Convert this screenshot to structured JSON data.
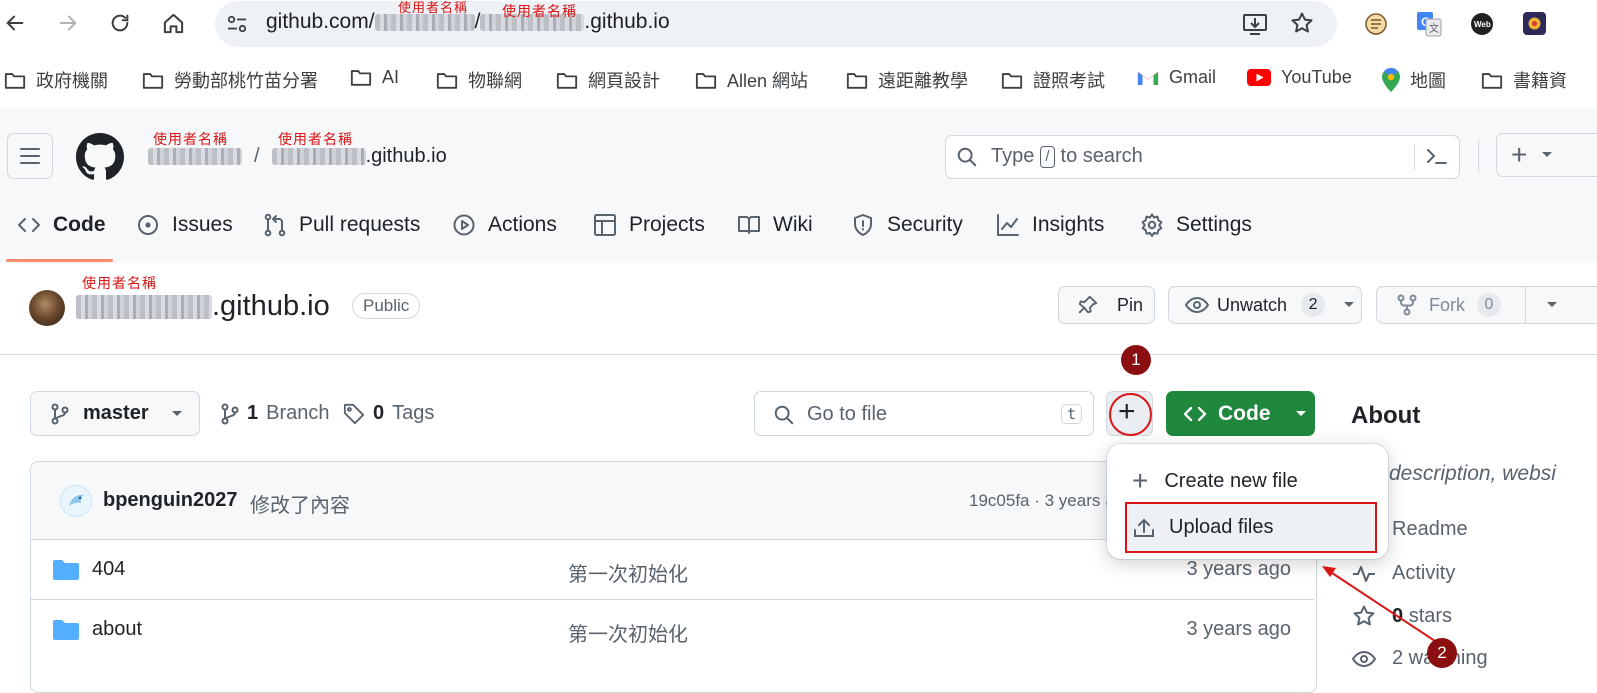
{
  "browser": {
    "url_prefix": "github.com/",
    "url_sep": "/",
    "url_suffix": ".github.io",
    "annotation_url": "使用者名稱",
    "bookmarks": [
      {
        "label": "政府機關",
        "icon": "folder"
      },
      {
        "label": "勞動部桃竹苗分署",
        "icon": "folder"
      },
      {
        "label": "AI",
        "icon": "folder"
      },
      {
        "label": "物聯網",
        "icon": "folder"
      },
      {
        "label": "網頁設計",
        "icon": "folder"
      },
      {
        "label": "Allen 網站",
        "icon": "folder"
      },
      {
        "label": "遠距離教學",
        "icon": "folder"
      },
      {
        "label": "證照考試",
        "icon": "folder"
      },
      {
        "label": "Gmail",
        "icon": "gmail"
      },
      {
        "label": "YouTube",
        "icon": "youtube"
      },
      {
        "label": "地圖",
        "icon": "maps"
      },
      {
        "label": "書籍資",
        "icon": "folder"
      }
    ]
  },
  "header": {
    "breadcrumb_sep": "/",
    "repo_suffix": ".github.io",
    "annotation": "使用者名稱",
    "search_type": "Type",
    "search_key": "/",
    "search_rest": "to search",
    "create_symbol": "+"
  },
  "tabs": [
    "Code",
    "Issues",
    "Pull requests",
    "Actions",
    "Projects",
    "Wiki",
    "Security",
    "Insights",
    "Settings"
  ],
  "repo": {
    "name_suffix": ".github.io",
    "visibility": "Public",
    "annotation": "使用者名稱",
    "pin_label": "Pin",
    "unwatch_label": "Unwatch",
    "watch_count": "2",
    "fork_label": "Fork",
    "fork_count": "0"
  },
  "toolbar": {
    "branch": "master",
    "branch_count": "1",
    "branch_label": "Branch",
    "tag_count": "0",
    "tag_label": "Tags",
    "go_to_file_placeholder": "Go to file",
    "go_to_file_key": "t",
    "add_symbol": "+",
    "code_label": "Code"
  },
  "commit": {
    "author": "bpenguin2027",
    "message": "修改了內容",
    "hash_info": "19c05fa · 3 years a"
  },
  "files": [
    {
      "name": "404",
      "message": "第一次初始化",
      "time": "3 years ago"
    },
    {
      "name": "about",
      "message": "第一次初始化",
      "time": "3 years ago"
    }
  ],
  "add_menu": {
    "create_label": "Create new file",
    "upload_label": "Upload files"
  },
  "about": {
    "title": "About",
    "description": "description, websi",
    "readme": "Readme",
    "activity": "Activity",
    "stars_count": "0",
    "stars_label": "stars",
    "watching": "2 watching"
  },
  "steps": [
    "1",
    "2"
  ],
  "colors": {
    "accent_green": "#1f883d",
    "annotation_red": "#d91515",
    "step_badge": "#8b0f10",
    "folder_blue": "#54aeff",
    "tab_underline": "#fd8c73"
  }
}
